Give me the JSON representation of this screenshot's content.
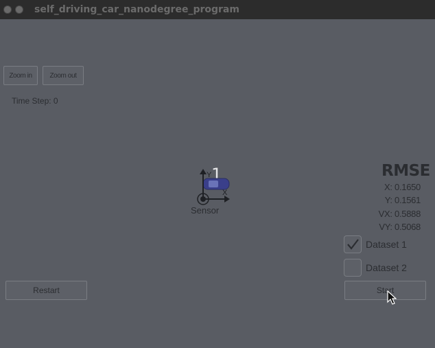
{
  "window": {
    "title": "self_driving_car_nanodegree_program"
  },
  "toolbar": {
    "zoom_in_label": "Zoom in",
    "zoom_out_label": "Zoom out"
  },
  "status": {
    "time_step": "Time Step: 0"
  },
  "scene": {
    "step_number": "1",
    "sensor_label": "Sensor",
    "axis_y_label": "Y",
    "axis_x_label": "X",
    "car_color": "#3a3f8a"
  },
  "rmse": {
    "title": "RMSE",
    "x": "X: 0.1650",
    "y": "Y: 0.1561",
    "vx": "VX: 0.5888",
    "vy": "VY: 0.5068"
  },
  "datasets": [
    {
      "label": "Dataset 1",
      "checked": true
    },
    {
      "label": "Dataset 2",
      "checked": false
    }
  ],
  "controls": {
    "restart_label": "Restart",
    "start_label": "Start"
  },
  "icons": {
    "window_close": "close-icon",
    "window_minimize": "minimize-icon",
    "checkmark": "check-icon",
    "cursor": "mouse-cursor-icon"
  },
  "colors": {
    "background": "#595c63",
    "titlebar": "#2c2c2c",
    "text": "#2b2d31"
  }
}
